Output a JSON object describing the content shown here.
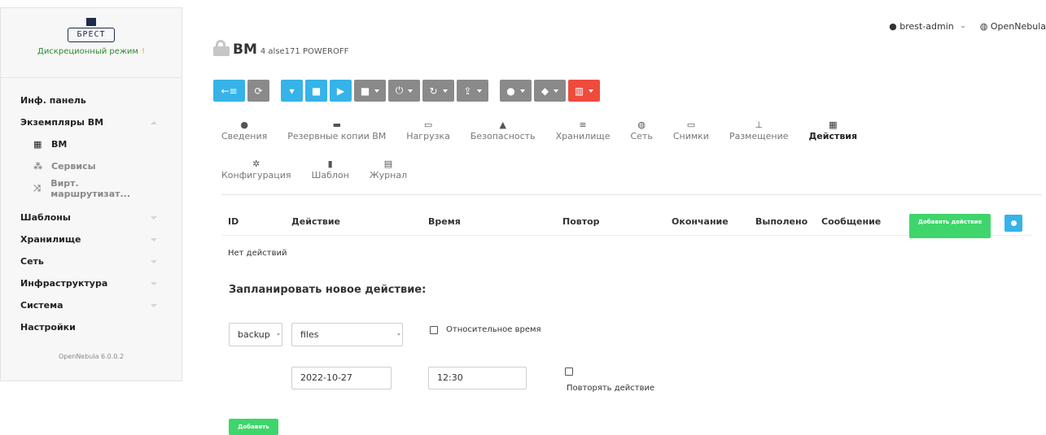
{
  "sidebar": {
    "logo_text": "БРЕСТ",
    "mode_text": "Дискреционный режим",
    "mode_warn_icon": "!",
    "items": [
      {
        "label": "Инф. панель"
      },
      {
        "label": "Экземпляры ВМ"
      },
      {
        "label": "ВМ",
        "icon": "grid-icon"
      },
      {
        "label": "Сервисы",
        "icon": "services-icon"
      },
      {
        "label": "Вирт. маршрутизат...",
        "icon": "router-icon"
      },
      {
        "label": "Шаблоны"
      },
      {
        "label": "Хранилище"
      },
      {
        "label": "Сеть"
      },
      {
        "label": "Инфраструктура"
      },
      {
        "label": "Система"
      },
      {
        "label": "Настройки"
      }
    ],
    "version": "OpenNebula 6.0.0.2"
  },
  "topbar": {
    "user": "brest-admin",
    "zone": "OpenNebula"
  },
  "header": {
    "title": "ВМ",
    "subtitle": "4 alse171 POWEROFF"
  },
  "tabs": {
    "row1": [
      "Сведения",
      "Резервные копии ВМ",
      "Нагрузка",
      "Безопасность",
      "Хранилище",
      "Сеть",
      "Снимки",
      "Размещение",
      "Действия"
    ],
    "row2": [
      "Конфигурация",
      "Шаблон",
      "Журнал"
    ],
    "active": "Действия"
  },
  "table": {
    "columns": [
      "ID",
      "Действие",
      "Время",
      "Повтор",
      "Окончание",
      "Выполено",
      "Сообщение"
    ],
    "add_button": "Добавить действие",
    "empty_text": "Нет действий"
  },
  "schedule": {
    "title": "Запланировать новое действие:",
    "action_value": "backup",
    "target_value": "files",
    "relative_label": "Относительное время",
    "date_value": "2022-10-27",
    "time_value": "12:30",
    "repeat_label": "Повторять действие",
    "add_button": "Добавить"
  },
  "colors": {
    "blue": "#36b3e8",
    "grey": "#8a8a8a",
    "red": "#ef4b3c",
    "green": "#3ed66b"
  }
}
